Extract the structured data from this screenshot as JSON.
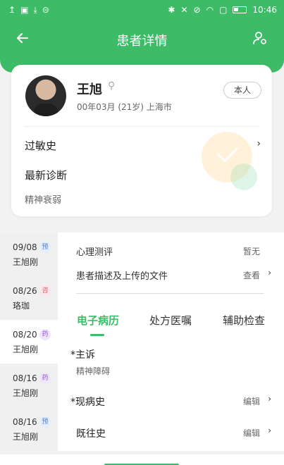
{
  "status_bar": {
    "time": "10:46",
    "left_icons": [
      "↥",
      "▣",
      "⤓",
      "⊝"
    ],
    "right_icons": [
      "✱",
      "✕",
      "⊘",
      "◠",
      "▢"
    ]
  },
  "header": {
    "title": "患者详情",
    "back_icon": "arrow-left-icon",
    "person_icon": "person-settings-icon",
    "color": "#3dbb67"
  },
  "patient": {
    "name": "王旭",
    "gender_symbol": "⚲",
    "info": "00年03月 (21岁)  上海市",
    "self_label": "本人"
  },
  "sections": {
    "allergy_label": "过敏史",
    "diagnosis_label": "最新诊断",
    "diagnosis_value": "精神衰弱"
  },
  "visits": [
    {
      "date": "09/08",
      "tag": "预",
      "name": "王旭刚",
      "tag_bg": "#e4eefc",
      "tag_color": "#4a7fd6"
    },
    {
      "date": "08/26",
      "tag": "咨",
      "name": "珞珈",
      "tag_bg": "#fde7ea",
      "tag_color": "#e06070"
    },
    {
      "date": "08/20",
      "tag": "药",
      "name": "王旭刚",
      "tag_bg": "#efe4f9",
      "tag_color": "#9a5ad0"
    },
    {
      "date": "08/16",
      "tag": "药",
      "name": "王旭刚",
      "tag_bg": "#efe4f9",
      "tag_color": "#9a5ad0"
    },
    {
      "date": "08/16",
      "tag": "预",
      "name": "王旭刚",
      "tag_bg": "#e4eefc",
      "tag_color": "#4a7fd6"
    }
  ],
  "detail": {
    "assessment_label": "心理测评",
    "assessment_value": "暂无",
    "files_label": "患者描述及上传的文件",
    "files_value": "查看",
    "tabs": [
      "电子病历",
      "处方医嘱",
      "辅助检查"
    ],
    "chief_label": "*主诉",
    "chief_value": "精神障碍",
    "present_label": "*现病史",
    "present_action": "编辑",
    "past_label": "既往史",
    "past_action": "编辑"
  }
}
